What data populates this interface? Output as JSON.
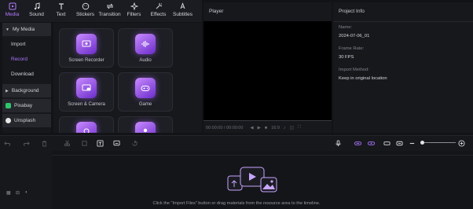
{
  "colors": {
    "accent": "#a977ff",
    "panel": "#17181c",
    "background": "#121316"
  },
  "toolbar": {
    "tabs": [
      {
        "label": "Media",
        "icon": "media-icon",
        "active": true
      },
      {
        "label": "Sound",
        "icon": "music-note-icon",
        "active": false
      },
      {
        "label": "Text",
        "icon": "text-icon",
        "active": false
      },
      {
        "label": "Stickers",
        "icon": "sticker-icon",
        "active": false
      },
      {
        "label": "Transition",
        "icon": "transition-icon",
        "active": false
      },
      {
        "label": "Filters",
        "icon": "filter-icon",
        "active": false
      },
      {
        "label": "Effects",
        "icon": "effects-icon",
        "active": false
      },
      {
        "label": "Subtitles",
        "icon": "subtitles-icon",
        "active": false
      }
    ]
  },
  "sidebar": {
    "my_media": "My Media",
    "import": "Import",
    "record": "Record",
    "download": "Download",
    "background": "Background",
    "pixabay": "Pixabay",
    "unsplash": "Unsplash"
  },
  "media_cards": [
    {
      "label": "Screen Recorder",
      "icon": "screen-recorder-icon"
    },
    {
      "label": "Audio",
      "icon": "audio-waveform-icon"
    },
    {
      "label": "Screen & Camera",
      "icon": "screen-camera-icon"
    },
    {
      "label": "Game",
      "icon": "gamepad-icon"
    },
    {
      "label": "",
      "icon": "webcam-icon"
    },
    {
      "label": "",
      "icon": "avatar-icon"
    }
  ],
  "player": {
    "title": "Player",
    "time": "00:00:00 / 00:00:00",
    "ratio": "16:9"
  },
  "project_info": {
    "title": "Project Info",
    "name_label": "Name:",
    "name_value": "2024-07-06_01",
    "frame_rate_label": "Frame Rate:",
    "frame_rate_value": "30 FPS",
    "import_method_label": "Import Method:",
    "import_method_value": "Keep in original location"
  },
  "timeline": {
    "hint": "Click the \"Import Files\" button or drag materials from the resource area to the timeline."
  }
}
